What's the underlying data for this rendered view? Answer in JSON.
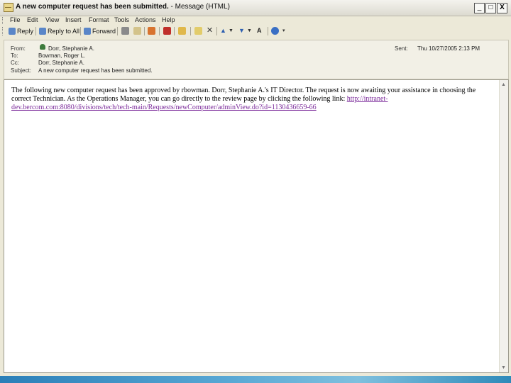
{
  "window": {
    "title_bold": "A new computer request has been submitted.",
    "title_rest": " - Message (HTML)",
    "minimize": "_",
    "maximize": "□",
    "close": "X"
  },
  "menu": [
    "File",
    "Edit",
    "View",
    "Insert",
    "Format",
    "Tools",
    "Actions",
    "Help"
  ],
  "toolbar": {
    "reply": "Reply",
    "reply_all": "Reply to All",
    "forward": "Forward"
  },
  "header": {
    "from_label": "From:",
    "from_value": "Dorr, Stephanie A.",
    "to_label": "To:",
    "to_value": "Bowman, Roger L.",
    "cc_label": "Cc:",
    "cc_value": "Dorr, Stephanie A.",
    "subject_label": "Subject:",
    "subject_value": "A new computer request has been submitted.",
    "sent_label": "Sent:",
    "sent_value": "Thu 10/27/2005 2:13 PM"
  },
  "message": {
    "body_text": "The following new computer request has been approved by rbowman. Dorr, Stephanie A.'s IT Director. The request is now awaiting your assistance in choosing the correct Technician. As the Operations Manager, you can go directly to the review page by clicking the following link: ",
    "link_text": "http://intranet-dev.bercom.com:8080/divisions/tech/tech-main/Requests/newComputer/adminView.do?id=1130436659-66"
  },
  "colors": {
    "link": "#7b2a9a",
    "taskbar": "#2b7fb8"
  }
}
